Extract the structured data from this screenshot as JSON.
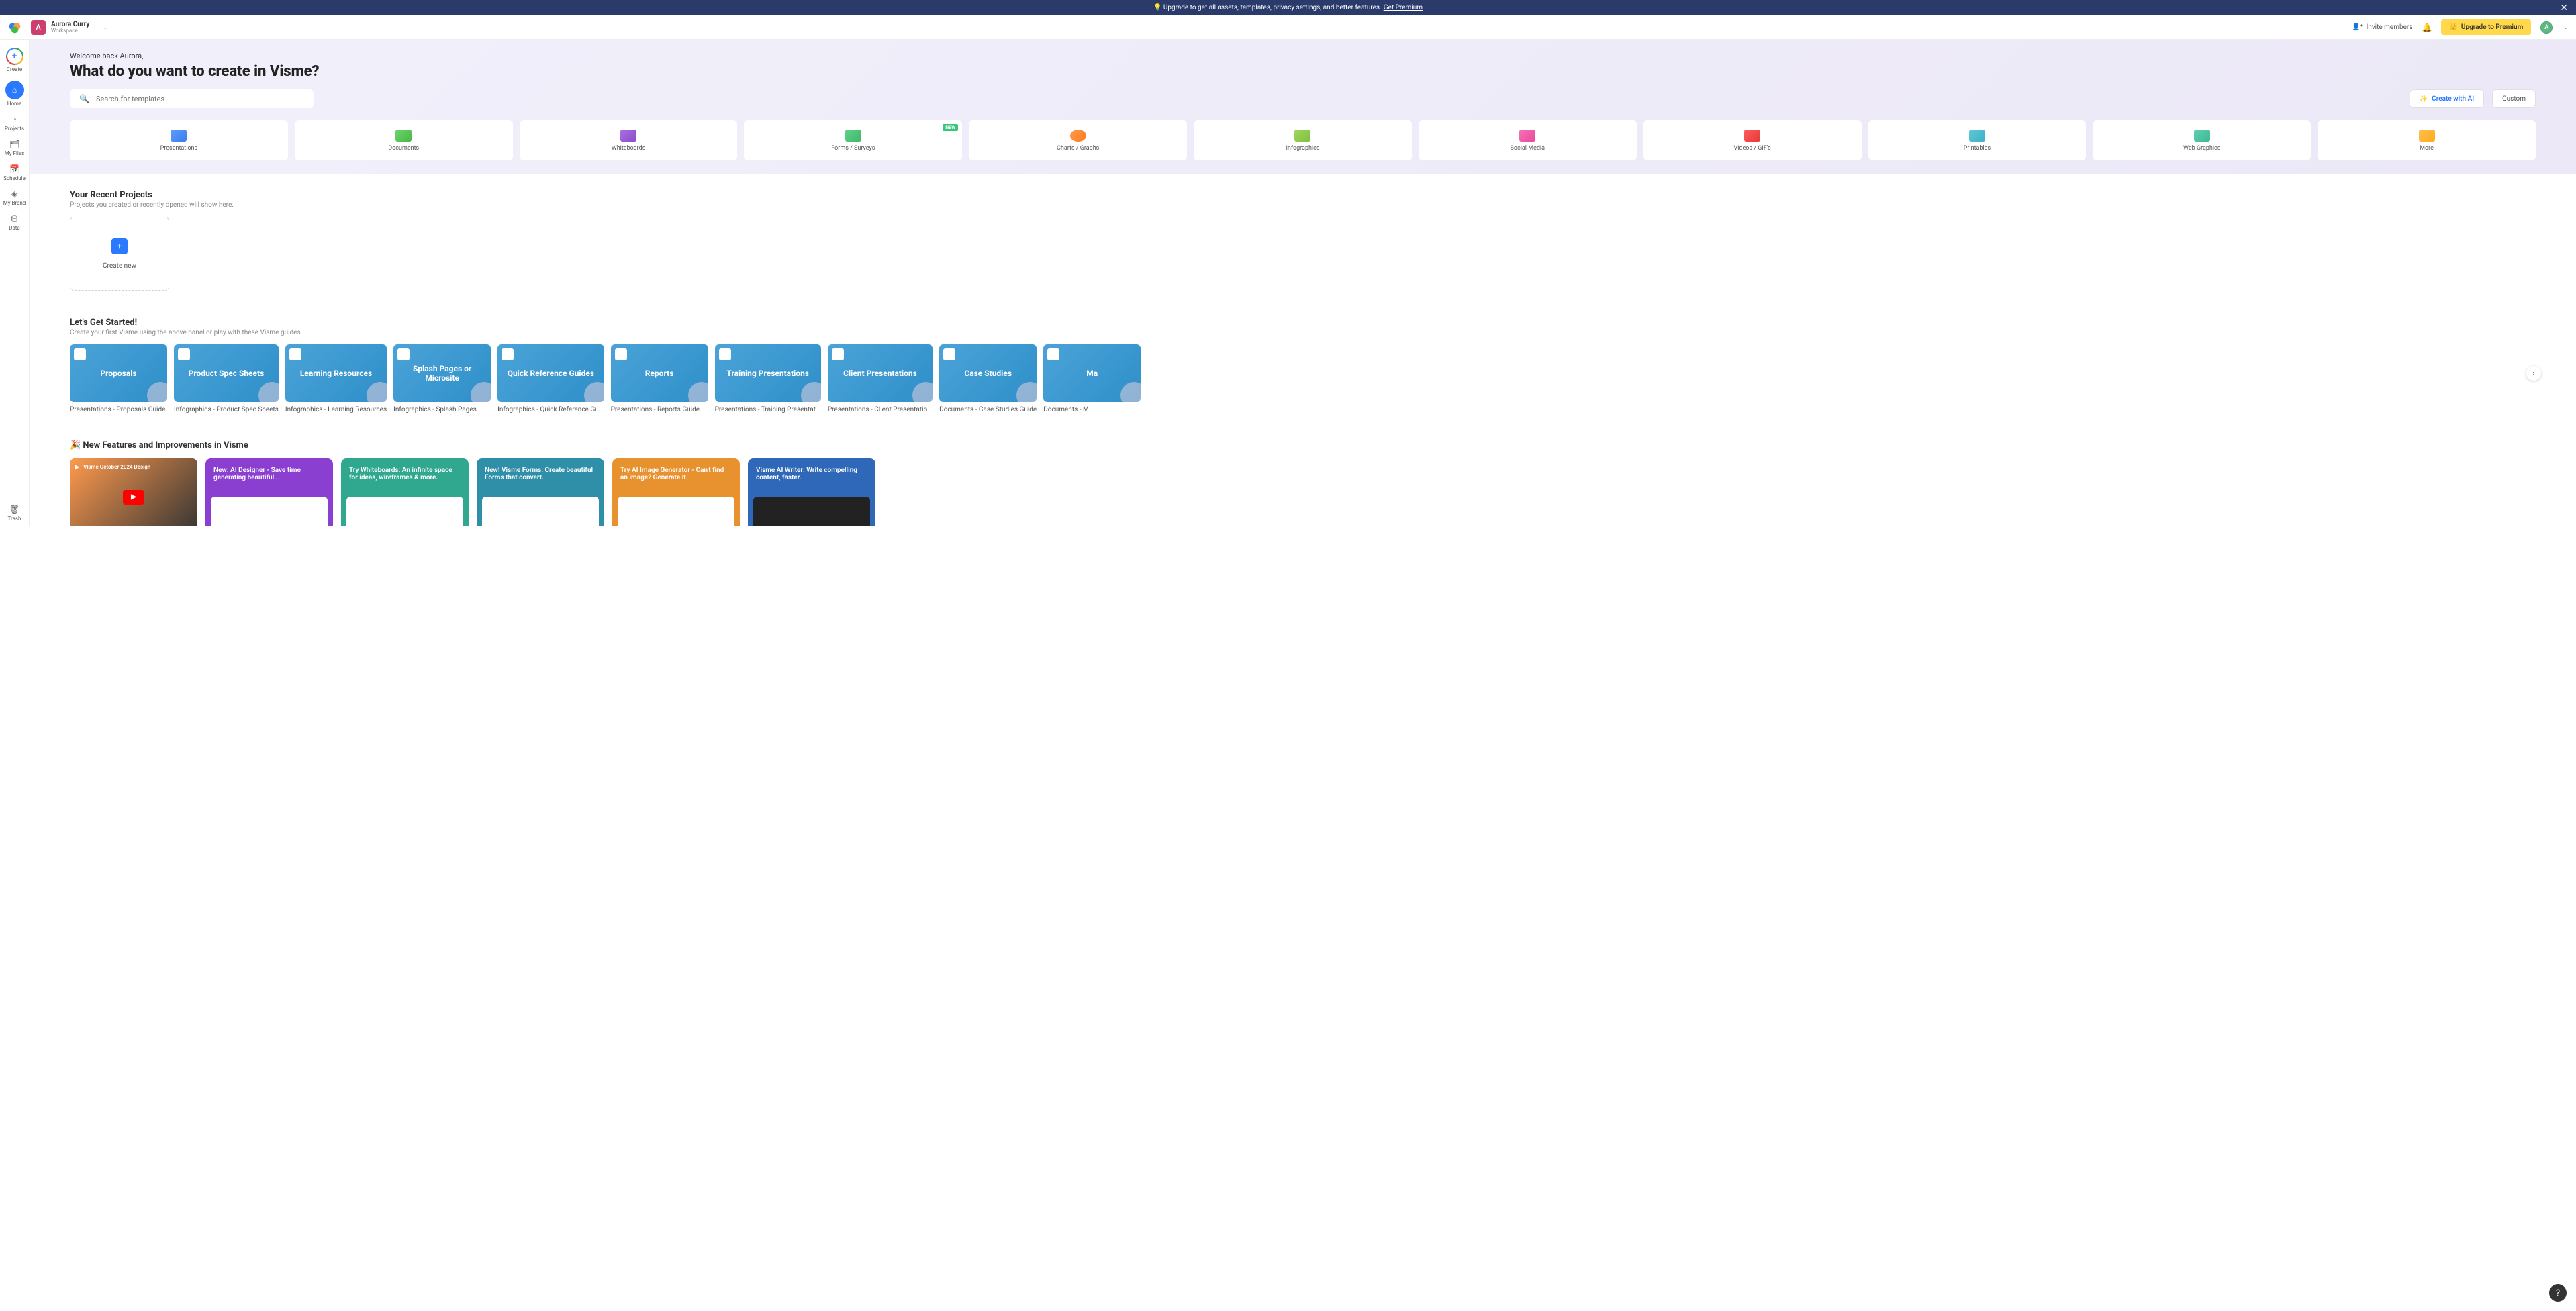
{
  "banner": {
    "text": "💡 Upgrade to get all assets, templates, privacy settings, and better features.",
    "link": "Get Premium"
  },
  "header": {
    "user_name": "Aurora Curry",
    "workspace": "Workspace",
    "avatar_letter": "A",
    "invite": "Invite members",
    "upgrade": "Upgrade to Premium"
  },
  "sidebar": {
    "create": "Create",
    "home": "Home",
    "projects": "Projects",
    "myfiles": "My Files",
    "schedule": "Schedule",
    "mybrand": "My Brand",
    "data": "Data",
    "trash": "Trash"
  },
  "hero": {
    "welcome": "Welcome back Aurora,",
    "headline": "What do you want to create in Visme?",
    "search_placeholder": "Search for templates",
    "create_ai": "Create with AI",
    "custom": "Custom",
    "new_badge": "NEW"
  },
  "categories": [
    {
      "label": "Presentations"
    },
    {
      "label": "Documents"
    },
    {
      "label": "Whiteboards"
    },
    {
      "label": "Forms / Surveys"
    },
    {
      "label": "Charts / Graphs"
    },
    {
      "label": "Infographics"
    },
    {
      "label": "Social Media"
    },
    {
      "label": "Videos / GIF's"
    },
    {
      "label": "Printables"
    },
    {
      "label": "Web Graphics"
    },
    {
      "label": "More"
    }
  ],
  "recent": {
    "title": "Your Recent Projects",
    "subtitle": "Projects you created or recently opened will show here.",
    "create_new": "Create new"
  },
  "guides": {
    "title": "Let's Get Started!",
    "subtitle": "Create your first Visme using the above panel or play with these Visme guides.",
    "items": [
      {
        "thumb": "Proposals",
        "caption": "Presentations - Proposals Guide"
      },
      {
        "thumb": "Product Spec Sheets",
        "caption": "Infographics - Product Spec Sheets"
      },
      {
        "thumb": "Learning Resources",
        "caption": "Infographics - Learning Resources"
      },
      {
        "thumb": "Splash Pages or Microsite",
        "caption": "Infographics - Splash Pages"
      },
      {
        "thumb": "Quick Reference Guides",
        "caption": "Infographics - Quick Reference Gu..."
      },
      {
        "thumb": "Reports",
        "caption": "Presentations - Reports Guide"
      },
      {
        "thumb": "Training Presentations",
        "caption": "Presentations - Training Presentat..."
      },
      {
        "thumb": "Client Presentations",
        "caption": "Presentations - Client Presentatio..."
      },
      {
        "thumb": "Case Studies",
        "caption": "Documents - Case Studies Guide"
      },
      {
        "thumb": "Ma",
        "caption": "Documents - M"
      }
    ]
  },
  "features": {
    "title": "🎉 New Features and Improvements in Visme",
    "video_title": "Visme October 2024 Design",
    "items": [
      {
        "text": "New: AI Designer - Save time generating beautiful...",
        "color": "#8a3fd1"
      },
      {
        "text": "Try Whiteboards: An infinite space for ideas, wireframes & more.",
        "color": "#2fa88f"
      },
      {
        "text": "New! Visme Forms: Create beautiful Forms that convert.",
        "color": "#2f8fa8"
      },
      {
        "text": "Try AI Image Generator - Can't find an image? Generate it.",
        "color": "#e8922f"
      },
      {
        "text": "Visme AI Writer: Write compelling content, faster.",
        "color": "#2f68b8"
      }
    ]
  },
  "help": "?"
}
